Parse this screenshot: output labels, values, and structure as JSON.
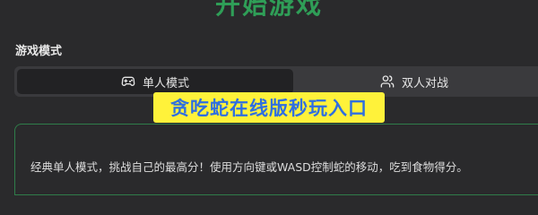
{
  "page": {
    "title": "开始游戏"
  },
  "mode_section": {
    "label": "游戏模式",
    "tabs": [
      {
        "label": "单人模式",
        "icon": "gamepad-icon",
        "selected": true
      },
      {
        "label": "双人对战",
        "icon": "users-icon",
        "selected": false
      }
    ]
  },
  "content": {
    "description": "经典单人模式，挑战自己的最高分！使用方向键或WASD控制蛇的移动，吃到食物得分。"
  },
  "banner": {
    "text": "贪吃蛇在线版秒玩入口"
  },
  "colors": {
    "background": "#2a2a2c",
    "accent_green": "#2f9e57",
    "banner_bg": "#fff23a",
    "banner_text": "#2f6fe0"
  }
}
